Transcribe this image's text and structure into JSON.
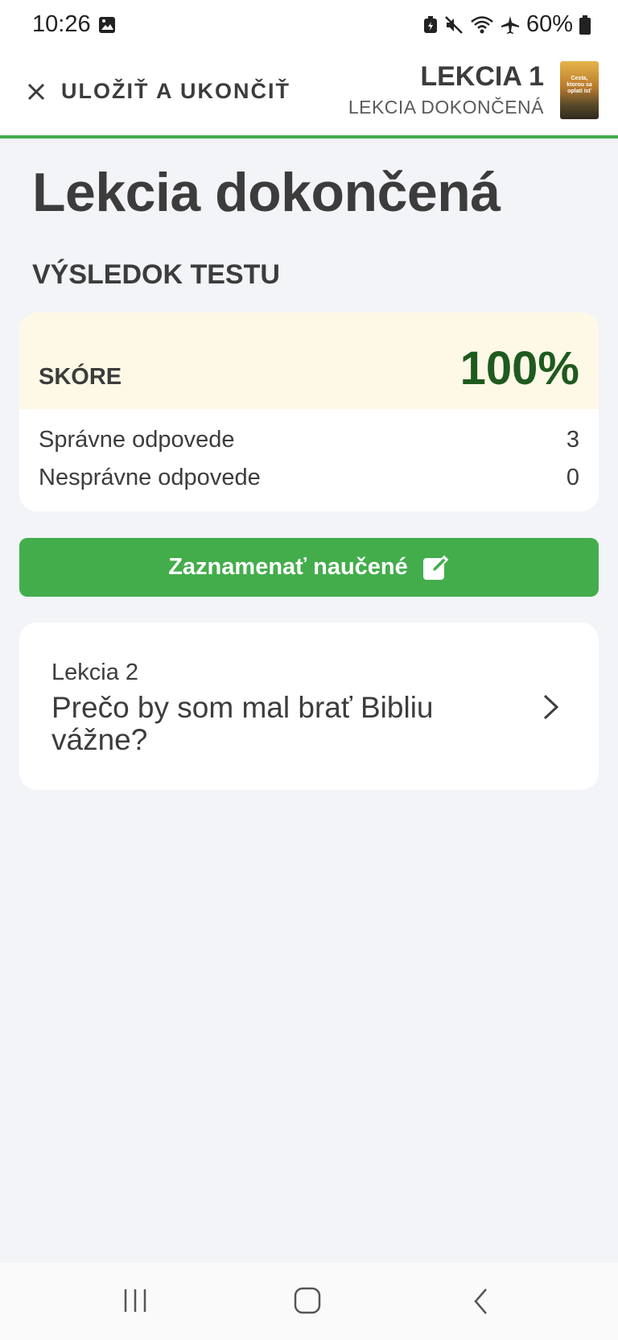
{
  "status_bar": {
    "time": "10:26",
    "battery": "60%",
    "icons": [
      "gallery-icon",
      "battery-saver-icon",
      "mute-icon",
      "wifi-icon",
      "airplane-icon",
      "battery-icon"
    ]
  },
  "header": {
    "close_label": "ULOŽIŤ A UKONČIŤ",
    "lesson_title": "LEKCIA 1",
    "lesson_subtitle": "LEKCIA DOKONČENÁ",
    "thumbnail_text": "Cesta, ktorou sa oplatí ísť"
  },
  "main": {
    "title": "Lekcia dokončená",
    "section_label": "VÝSLEDOK TESTU",
    "score": {
      "label": "SKÓRE",
      "value": "100%",
      "rows": [
        {
          "label": "Správne odpovede",
          "value": "3"
        },
        {
          "label": "Nesprávne odpovede",
          "value": "0"
        }
      ]
    },
    "record_button_label": "Zaznamenať naučené",
    "next_lesson": {
      "number_label": "Lekcia 2",
      "title": "Prečo by som mal brať Bibliu vážne?"
    }
  },
  "colors": {
    "accent_green": "#43ad4b",
    "score_green": "#1f5a1f",
    "score_highlight_bg": "#fdf9e6",
    "page_bg": "#f2f4f8"
  },
  "nav_bar": {
    "icons": [
      "recent-apps-icon",
      "home-icon",
      "back-icon"
    ]
  }
}
